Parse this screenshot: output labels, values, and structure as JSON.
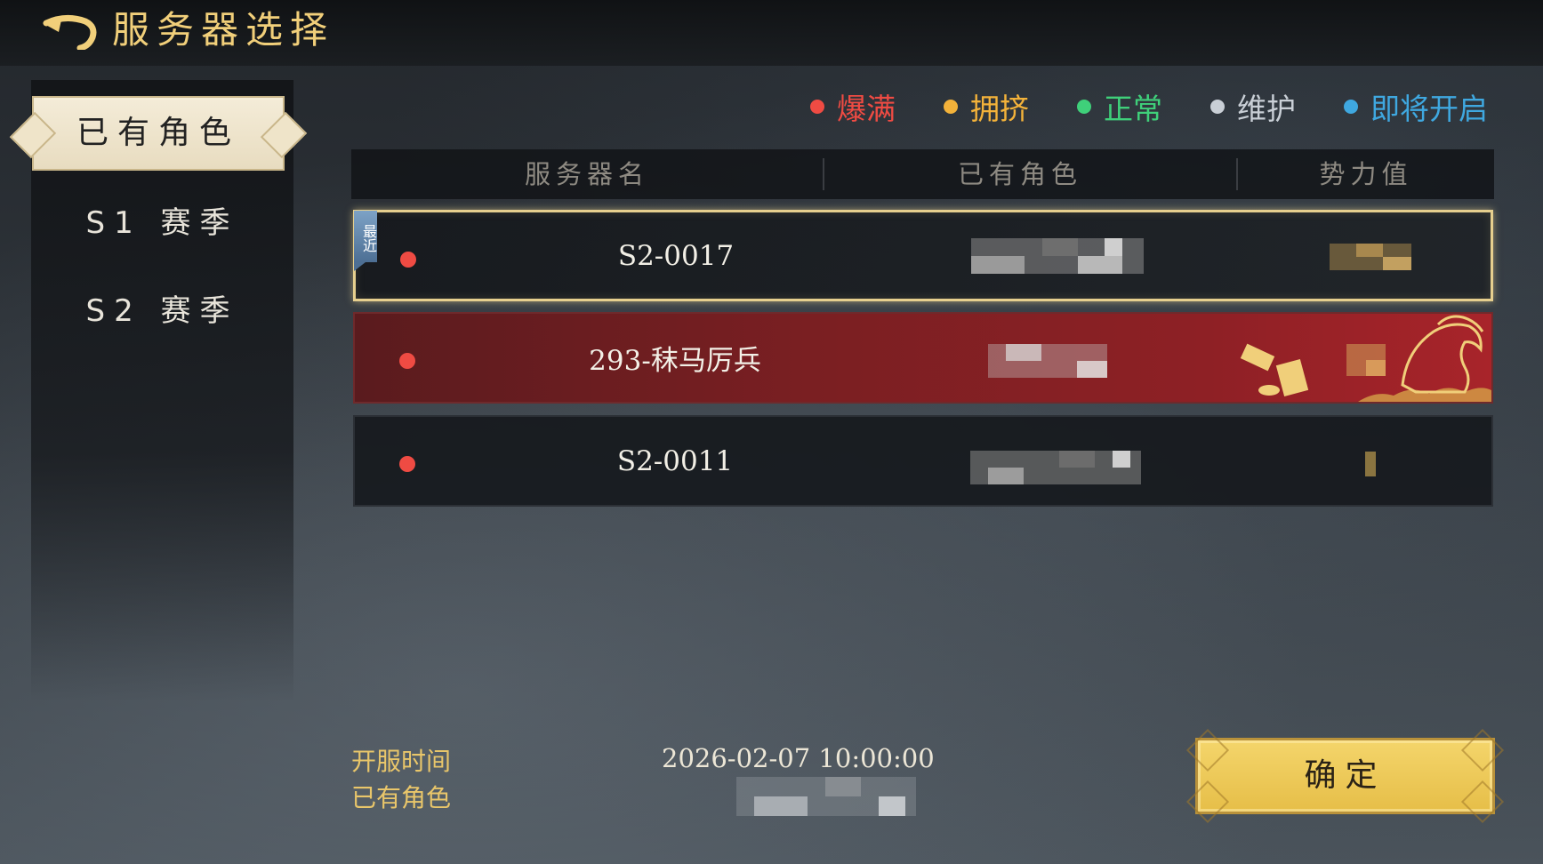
{
  "header": {
    "title": "服务器选择"
  },
  "sidebar": {
    "tabs": [
      {
        "label": "已有角色",
        "active": true
      },
      {
        "label": "S1 赛季",
        "active": false
      },
      {
        "label": "S2 赛季",
        "active": false
      }
    ]
  },
  "legend": [
    {
      "label": "爆满",
      "color": "#ef4b43"
    },
    {
      "label": "拥挤",
      "color": "#f3b23a"
    },
    {
      "label": "正常",
      "color": "#3fd07a"
    },
    {
      "label": "维护",
      "color": "#c9cfd6"
    },
    {
      "label": "即将开启",
      "color": "#3fa8e0"
    }
  ],
  "table": {
    "columns": [
      "服务器名",
      "已有角色",
      "势力值"
    ],
    "rows": [
      {
        "name": "S2-0017",
        "status_color": "#ef4b43",
        "recent_tag": "最近"
      },
      {
        "name": "293-秣马厉兵",
        "status_color": "#ef4b43"
      },
      {
        "name": "S2-0011",
        "status_color": "#ef4b43"
      }
    ]
  },
  "footer": {
    "open_time_label": "开服时间",
    "open_time_value": "2026-02-07 10:00:00",
    "roles_label": "已有角色"
  },
  "confirm_label": "确定"
}
